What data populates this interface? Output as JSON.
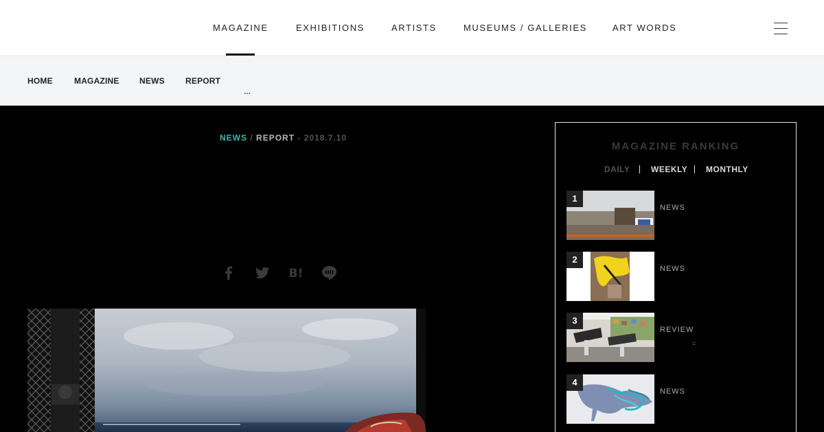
{
  "header": {
    "nav": [
      {
        "label": "MAGAZINE"
      },
      {
        "label": "EXHIBITIONS"
      },
      {
        "label": "ARTISTS"
      },
      {
        "label": "MUSEUMS / GALLERIES"
      },
      {
        "label": "ART WORDS"
      }
    ],
    "menu_icon": "hamburger-menu-icon"
  },
  "breadcrumb": {
    "items": [
      "HOME",
      "MAGAZINE",
      "NEWS",
      "REPORT"
    ],
    "ellipsis": "…"
  },
  "article": {
    "category": "NEWS",
    "separator": "/",
    "subcategory": "REPORT",
    "date": "- 2018.7.10",
    "share_icons": [
      "facebook-icon",
      "twitter-icon",
      "hatena-bookmark-icon",
      "line-icon"
    ],
    "hatena_glyph": "B!"
  },
  "ranking": {
    "title": "MAGAZINE RANKING",
    "tabs": [
      "DAILY",
      "WEEKLY",
      "MONTHLY"
    ],
    "active_tab": "DAILY",
    "items": [
      {
        "rank": "1",
        "category": "NEWS"
      },
      {
        "rank": "2",
        "category": "NEWS"
      },
      {
        "rank": "3",
        "category": "REVIEW"
      },
      {
        "rank": "4",
        "category": "NEWS"
      }
    ],
    "extra_mark": "="
  },
  "colors": {
    "accent": "#3fb7b1",
    "background": "#000000",
    "header": "#ffffff",
    "breadcrumb_bg": "#f4f5f7"
  }
}
